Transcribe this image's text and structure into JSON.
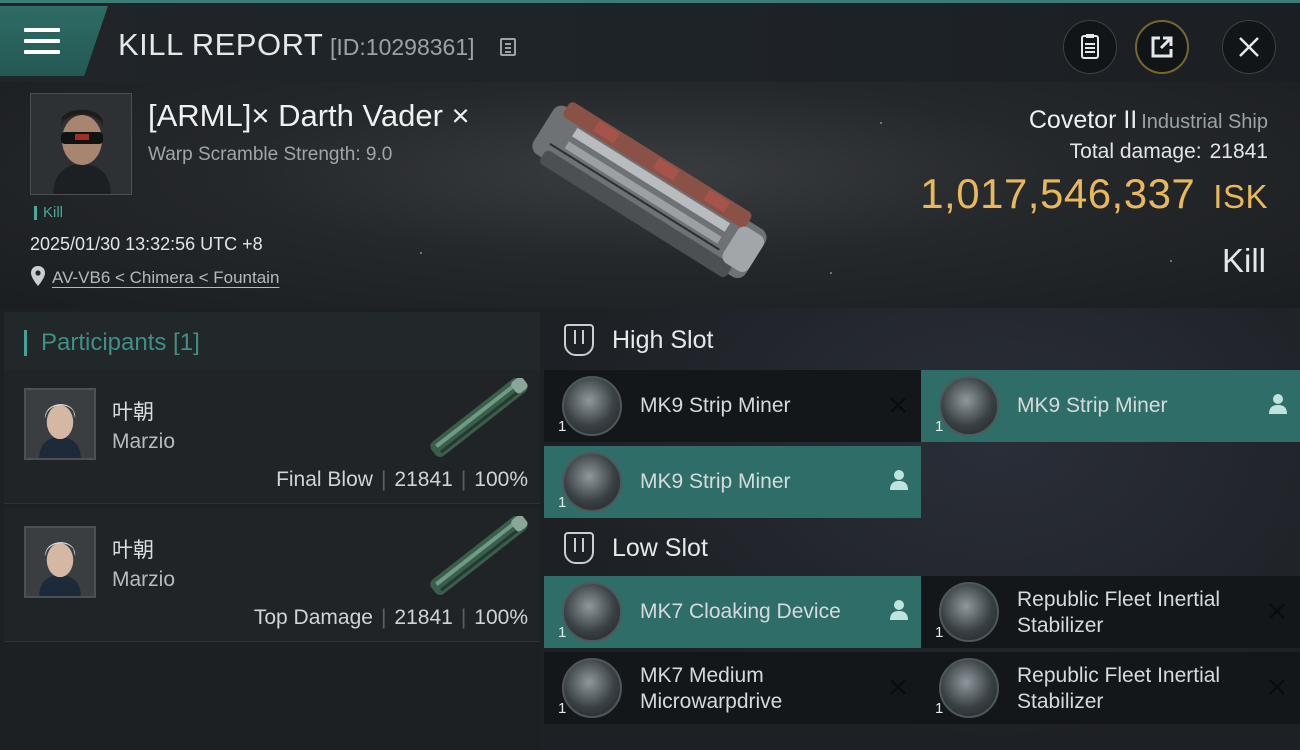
{
  "header": {
    "title": "KILL REPORT",
    "report_id": "[ID:10298361]"
  },
  "victim": {
    "name": "[ARML]× Darth Vader ×",
    "warp_scramble": "Warp Scramble Strength: 9.0",
    "tag": "Kill",
    "datetime": "2025/01/30 13:32:56 UTC +8",
    "location": "AV-VB6 < Chimera < Fountain",
    "ship_name": "Covetor II",
    "ship_class": "Industrial Ship",
    "damage_label": "Total damage:",
    "damage_value": "21841",
    "isk_value": "1,017,546,337",
    "isk_unit": "ISK",
    "kill_type": "Kill"
  },
  "participants": {
    "title": "Participants [1]",
    "rows": [
      {
        "cn": "叶朝",
        "name": "Marzio",
        "role": "Final Blow",
        "damage": "21841",
        "percent": "100%"
      },
      {
        "cn": "叶朝",
        "name": "Marzio",
        "role": "Top Damage",
        "damage": "21841",
        "percent": "100%"
      }
    ]
  },
  "slots": {
    "high": {
      "title": "High Slot",
      "modules": [
        {
          "name": "MK9 Strip Miner",
          "qty": "1",
          "state": "destroyed"
        },
        {
          "name": "MK9 Strip Miner",
          "qty": "1",
          "state": "dropped"
        },
        {
          "name": "MK9 Strip Miner",
          "qty": "1",
          "state": "dropped"
        }
      ]
    },
    "low": {
      "title": "Low Slot",
      "modules": [
        {
          "name": "MK7 Cloaking Device",
          "qty": "1",
          "state": "dropped"
        },
        {
          "name": "Republic Fleet Inertial Stabilizer",
          "qty": "1",
          "state": "destroyed"
        },
        {
          "name": "MK7 Medium Microwarpdrive",
          "qty": "1",
          "state": "destroyed"
        },
        {
          "name": "Republic Fleet Inertial Stabilizer",
          "qty": "1",
          "state": "destroyed"
        }
      ]
    }
  },
  "icons": {
    "menu": "menu-icon",
    "copy": "copy-icon",
    "report": "clipboard-icon",
    "share": "share-icon",
    "close": "close-icon",
    "location": "location-pin-icon",
    "slot": "slot-icon",
    "destroyed": "close-icon",
    "dropped": "user-icon"
  },
  "colors": {
    "accent": "#2f6e68",
    "isk": "#e8b85a",
    "kill_tag": "#4aa89c"
  }
}
